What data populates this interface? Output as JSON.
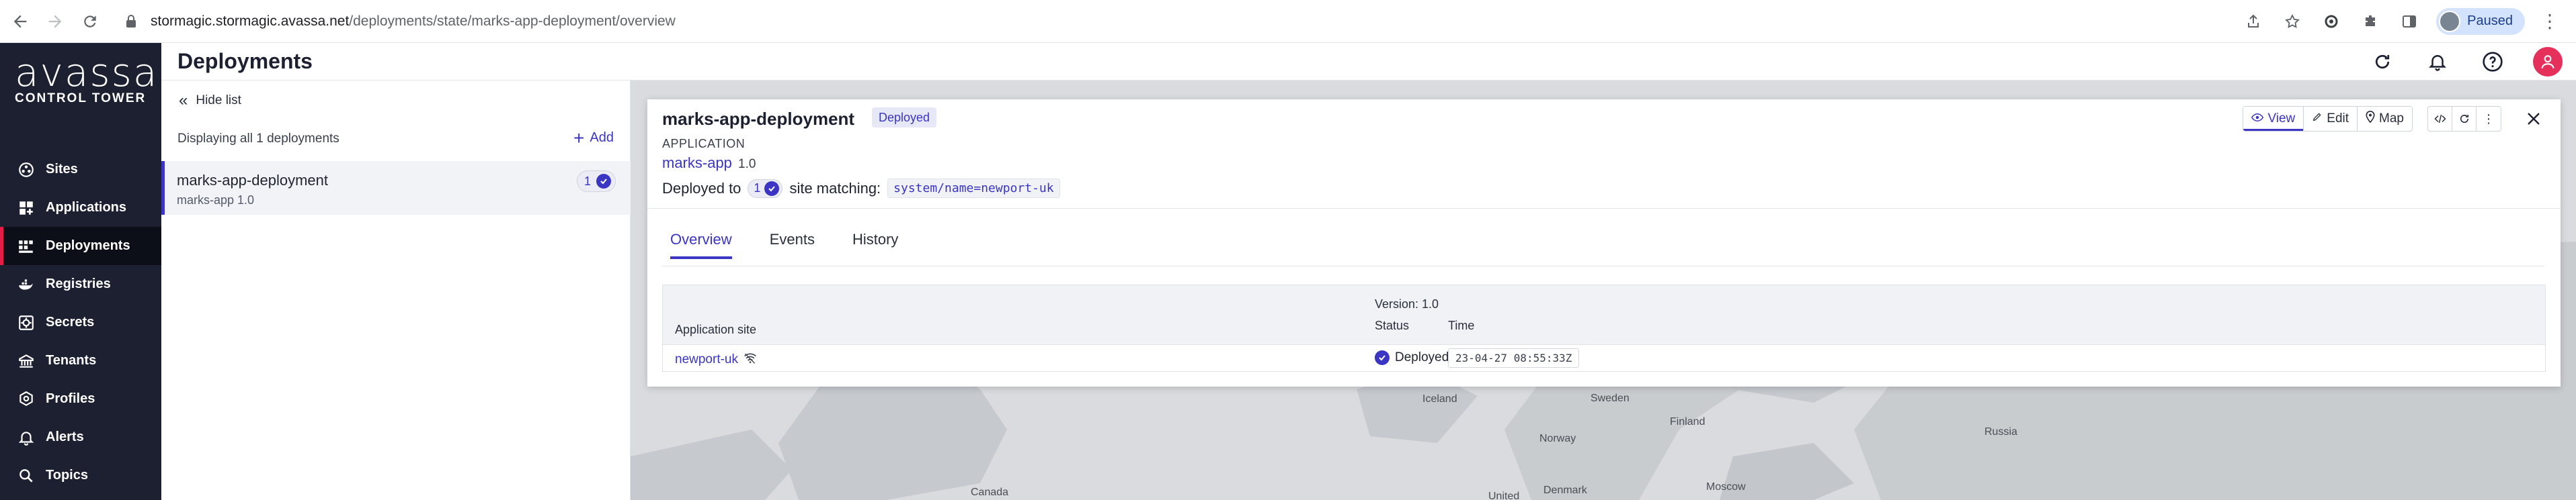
{
  "browser": {
    "url_host": "stormagic.stormagic.avassa.net",
    "url_path": "/deployments/state/marks-app-deployment/overview",
    "profile_label": "Paused"
  },
  "brand": {
    "name": "avassa",
    "sub": "CONTROL TOWER"
  },
  "sidebar": {
    "items": [
      {
        "label": "Sites",
        "icon": "sites-icon"
      },
      {
        "label": "Applications",
        "icon": "applications-icon"
      },
      {
        "label": "Deployments",
        "icon": "deployments-icon",
        "active": true
      },
      {
        "label": "Registries",
        "icon": "registries-icon"
      },
      {
        "label": "Secrets",
        "icon": "secrets-icon"
      },
      {
        "label": "Tenants",
        "icon": "tenants-icon"
      },
      {
        "label": "Profiles",
        "icon": "profiles-icon"
      },
      {
        "label": "Alerts",
        "icon": "alerts-icon"
      },
      {
        "label": "Topics",
        "icon": "topics-icon"
      }
    ]
  },
  "header": {
    "title": "Deployments"
  },
  "list": {
    "hide_label": "Hide list",
    "summary": "Displaying all 1 deployments",
    "add_label": "Add",
    "items": [
      {
        "name": "marks-app-deployment",
        "sub": "marks-app 1.0",
        "count": "1"
      }
    ]
  },
  "detail": {
    "title": "marks-app-deployment",
    "status": "Deployed",
    "type_label": "APPLICATION",
    "app_name": "marks-app",
    "app_version": "1.0",
    "deployed_to_prefix": "Deployed to",
    "site_count": "1",
    "deployed_to_suffix": "site matching:",
    "match_expr": "system/name=newport-uk",
    "toolbar": {
      "view": "View",
      "edit": "Edit",
      "map": "Map"
    },
    "tabs": [
      "Overview",
      "Events",
      "History"
    ],
    "table": {
      "version_label": "Version: 1.0",
      "col_site": "Application site",
      "col_status": "Status",
      "col_time": "Time",
      "rows": [
        {
          "site": "newport-uk",
          "status": "Deployed",
          "time": "23-04-27 08:55:33Z"
        }
      ]
    }
  },
  "map_labels": {
    "iceland": "Iceland",
    "sweden": "Sweden",
    "finland": "Finland",
    "norway": "Norway",
    "russia": "Russia",
    "canada": "Canada",
    "united": "United",
    "denmark": "Denmark",
    "moscow": "Moscow"
  },
  "colors": {
    "accent": "#3b35c3",
    "sidebar": "#1c2030",
    "active_marker": "#e11d48",
    "user": "#e5305b"
  }
}
